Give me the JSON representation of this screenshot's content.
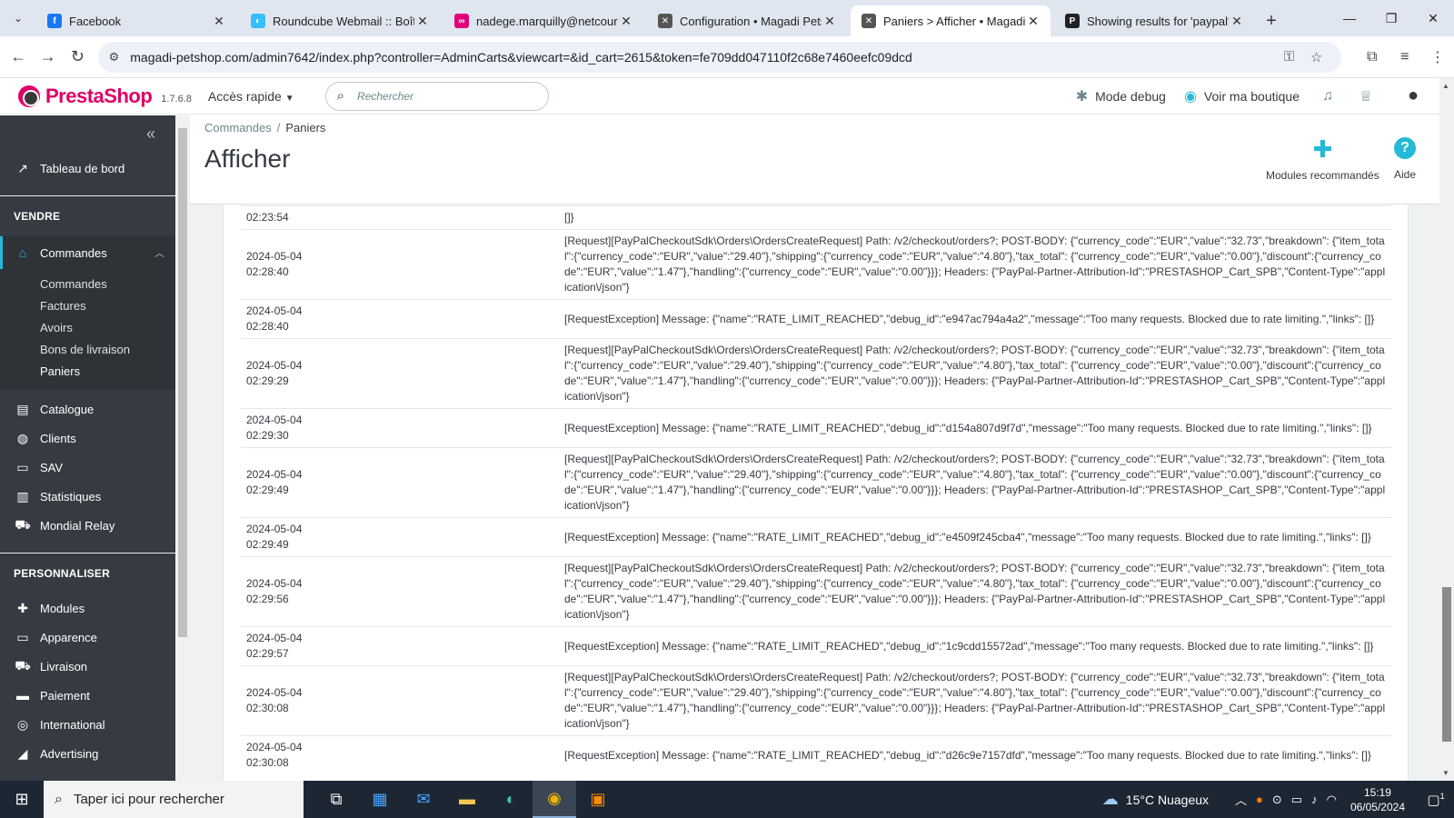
{
  "browser": {
    "tabs": [
      {
        "title": "Facebook",
        "favicon": "facebook-icon",
        "color": "#1877f2",
        "glyph": "f",
        "active": false
      },
      {
        "title": "Roundcube Webmail :: Boîte",
        "favicon": "roundcube-icon",
        "color": "#37beff",
        "glyph": "◐",
        "active": false
      },
      {
        "title": "nadege.marquilly@netcourrier",
        "favicon": "netcourrier-icon",
        "color": "#e2007a",
        "glyph": "∞",
        "active": false
      },
      {
        "title": "Configuration • Magadi Petshop",
        "favicon": "prestashop-icon",
        "color": "#555555",
        "glyph": "✕",
        "active": false
      },
      {
        "title": "Paniers > Afficher • Magadi Petshop",
        "favicon": "prestashop-icon",
        "color": "#555555",
        "glyph": "✕",
        "active": true
      },
      {
        "title": "Showing results for 'paypal'",
        "favicon": "p-icon",
        "color": "#222222",
        "glyph": "P",
        "active": false
      }
    ],
    "url": "magadi-petshop.com/admin7642/index.php?controller=AdminCarts&viewcart=&id_cart=2615&token=fe709dd047110f2c68e7460eefc09dcd"
  },
  "header": {
    "logo_main": "PrestaShop",
    "version": "1.7.6.8",
    "quick_access": "Accès rapide",
    "search_placeholder": "Rechercher",
    "debug_mode": "Mode debug",
    "view_shop": "Voir ma boutique"
  },
  "sidebar": {
    "dashboard": "Tableau de bord",
    "section_sell": "VENDRE",
    "orders": "Commandes",
    "orders_sub": [
      "Commandes",
      "Factures",
      "Avoirs",
      "Bons de livraison",
      "Paniers"
    ],
    "sell_items": [
      "Catalogue",
      "Clients",
      "SAV",
      "Statistiques",
      "Mondial Relay"
    ],
    "section_customize": "PERSONNALISER",
    "customize_items": [
      "Modules",
      "Apparence",
      "Livraison",
      "Paiement",
      "International",
      "Advertising"
    ]
  },
  "page": {
    "breadcrumb": [
      "Commandes",
      "Paniers"
    ],
    "title": "Afficher",
    "recommended_modules": "Modules recommandés",
    "help": "Aide"
  },
  "logs": [
    {
      "date": "02:23:54",
      "message": "[]}"
    },
    {
      "date": "2024-05-04\n02:28:40",
      "message": "[Request][PayPalCheckoutSdk\\Orders\\OrdersCreateRequest] Path: /v2/checkout/orders?; POST-BODY: {\"currency_code\":\"EUR\",\"value\":\"32.73\",\"breakdown\": {\"item_total\":{\"currency_code\":\"EUR\",\"value\":\"29.40\"},\"shipping\":{\"currency_code\":\"EUR\",\"value\":\"4.80\"},\"tax_total\": {\"currency_code\":\"EUR\",\"value\":\"0.00\"},\"discount\":{\"currency_code\":\"EUR\",\"value\":\"1.47\"},\"handling\":{\"currency_code\":\"EUR\",\"value\":\"0.00\"}}}; Headers: {\"PayPal-Partner-Attribution-Id\":\"PRESTASHOP_Cart_SPB\",\"Content-Type\":\"application\\/json\"}"
    },
    {
      "date": "2024-05-04\n02:28:40",
      "message": "[RequestException] Message: {\"name\":\"RATE_LIMIT_REACHED\",\"debug_id\":\"e947ac794a4a2\",\"message\":\"Too many requests. Blocked due to rate limiting.\",\"links\": []}"
    },
    {
      "date": "2024-05-04\n02:29:29",
      "message": "[Request][PayPalCheckoutSdk\\Orders\\OrdersCreateRequest] Path: /v2/checkout/orders?; POST-BODY: {\"currency_code\":\"EUR\",\"value\":\"32.73\",\"breakdown\": {\"item_total\":{\"currency_code\":\"EUR\",\"value\":\"29.40\"},\"shipping\":{\"currency_code\":\"EUR\",\"value\":\"4.80\"},\"tax_total\": {\"currency_code\":\"EUR\",\"value\":\"0.00\"},\"discount\":{\"currency_code\":\"EUR\",\"value\":\"1.47\"},\"handling\":{\"currency_code\":\"EUR\",\"value\":\"0.00\"}}}; Headers: {\"PayPal-Partner-Attribution-Id\":\"PRESTASHOP_Cart_SPB\",\"Content-Type\":\"application\\/json\"}"
    },
    {
      "date": "2024-05-04\n02:29:30",
      "message": "[RequestException] Message: {\"name\":\"RATE_LIMIT_REACHED\",\"debug_id\":\"d154a807d9f7d\",\"message\":\"Too many requests. Blocked due to rate limiting.\",\"links\": []}"
    },
    {
      "date": "2024-05-04\n02:29:49",
      "message": "[Request][PayPalCheckoutSdk\\Orders\\OrdersCreateRequest] Path: /v2/checkout/orders?; POST-BODY: {\"currency_code\":\"EUR\",\"value\":\"32.73\",\"breakdown\": {\"item_total\":{\"currency_code\":\"EUR\",\"value\":\"29.40\"},\"shipping\":{\"currency_code\":\"EUR\",\"value\":\"4.80\"},\"tax_total\": {\"currency_code\":\"EUR\",\"value\":\"0.00\"},\"discount\":{\"currency_code\":\"EUR\",\"value\":\"1.47\"},\"handling\":{\"currency_code\":\"EUR\",\"value\":\"0.00\"}}}; Headers: {\"PayPal-Partner-Attribution-Id\":\"PRESTASHOP_Cart_SPB\",\"Content-Type\":\"application\\/json\"}"
    },
    {
      "date": "2024-05-04\n02:29:49",
      "message": "[RequestException] Message: {\"name\":\"RATE_LIMIT_REACHED\",\"debug_id\":\"e4509f245cba4\",\"message\":\"Too many requests. Blocked due to rate limiting.\",\"links\": []}"
    },
    {
      "date": "2024-05-04\n02:29:56",
      "message": "[Request][PayPalCheckoutSdk\\Orders\\OrdersCreateRequest] Path: /v2/checkout/orders?; POST-BODY: {\"currency_code\":\"EUR\",\"value\":\"32.73\",\"breakdown\": {\"item_total\":{\"currency_code\":\"EUR\",\"value\":\"29.40\"},\"shipping\":{\"currency_code\":\"EUR\",\"value\":\"4.80\"},\"tax_total\": {\"currency_code\":\"EUR\",\"value\":\"0.00\"},\"discount\":{\"currency_code\":\"EUR\",\"value\":\"1.47\"},\"handling\":{\"currency_code\":\"EUR\",\"value\":\"0.00\"}}}; Headers: {\"PayPal-Partner-Attribution-Id\":\"PRESTASHOP_Cart_SPB\",\"Content-Type\":\"application\\/json\"}"
    },
    {
      "date": "2024-05-04\n02:29:57",
      "message": "[RequestException] Message: {\"name\":\"RATE_LIMIT_REACHED\",\"debug_id\":\"1c9cdd15572ad\",\"message\":\"Too many requests. Blocked due to rate limiting.\",\"links\": []}"
    },
    {
      "date": "2024-05-04\n02:30:08",
      "message": "[Request][PayPalCheckoutSdk\\Orders\\OrdersCreateRequest] Path: /v2/checkout/orders?; POST-BODY: {\"currency_code\":\"EUR\",\"value\":\"32.73\",\"breakdown\": {\"item_total\":{\"currency_code\":\"EUR\",\"value\":\"29.40\"},\"shipping\":{\"currency_code\":\"EUR\",\"value\":\"4.80\"},\"tax_total\": {\"currency_code\":\"EUR\",\"value\":\"0.00\"},\"discount\":{\"currency_code\":\"EUR\",\"value\":\"1.47\"},\"handling\":{\"currency_code\":\"EUR\",\"value\":\"0.00\"}}}; Headers: {\"PayPal-Partner-Attribution-Id\":\"PRESTASHOP_Cart_SPB\",\"Content-Type\":\"application\\/json\"}"
    },
    {
      "date": "2024-05-04\n02:30:08",
      "message": "[RequestException] Message: {\"name\":\"RATE_LIMIT_REACHED\",\"debug_id\":\"d26c9e7157dfd\",\"message\":\"Too many requests. Blocked due to rate limiting.\",\"links\": []}"
    }
  ],
  "taskbar": {
    "search_placeholder": "Taper ici pour rechercher",
    "temperature": "15°C",
    "weather": "Nuageux",
    "time": "15:19",
    "date": "06/05/2024",
    "notifications": "1"
  },
  "colors": {
    "accent": "#25b9d7",
    "brand": "#df0067",
    "sidebar_bg": "#363a41"
  }
}
